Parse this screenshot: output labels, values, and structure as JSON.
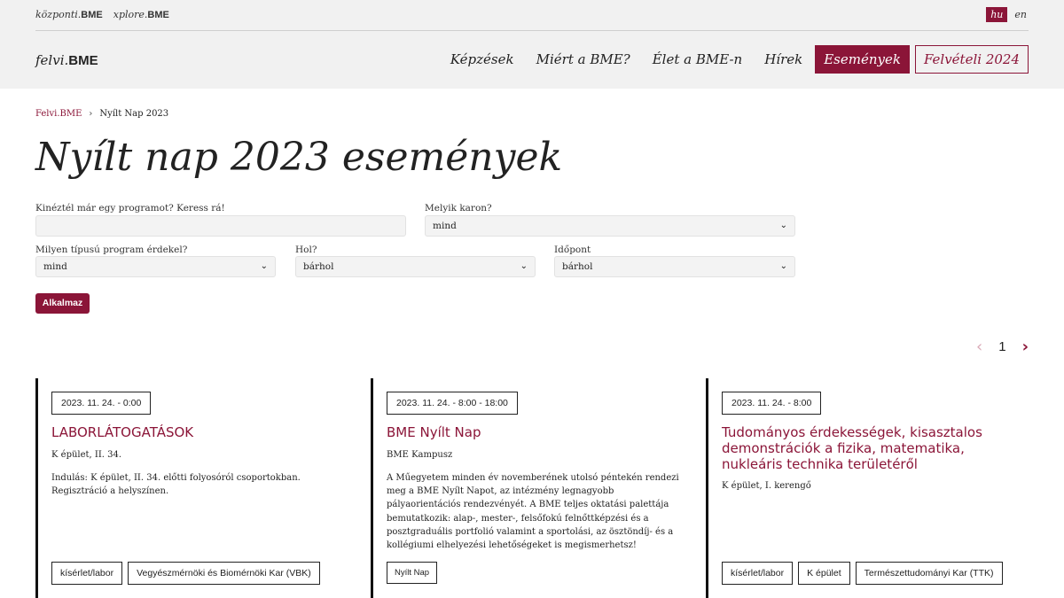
{
  "topbar": {
    "links": [
      {
        "prefix": "központi.",
        "brand": "BME"
      },
      {
        "prefix": "xplore.",
        "brand": "BME"
      }
    ],
    "lang_active": "hu",
    "lang_other": "en"
  },
  "header": {
    "logo_prefix": "felvi.",
    "logo_brand": "BME",
    "nav": {
      "kepzesek": "Képzések",
      "miert": "Miért a BME?",
      "elet": "Élet a BME-n",
      "hirek": "Hírek",
      "esemenyek": "Események",
      "felveteli": "Felvételi 2024"
    }
  },
  "breadcrumb": {
    "home": "Felvi.BME",
    "separator": "›",
    "current": "Nyílt Nap 2023"
  },
  "page_title": "Nyílt nap 2023 események",
  "filters": {
    "search_label": "Kinéztél már egy programot? Keress rá!",
    "search_value": "",
    "faculty_label": "Melyik karon?",
    "faculty_value": "mind",
    "type_label": "Milyen típusú program érdekel?",
    "type_value": "mind",
    "where_label": "Hol?",
    "where_value": "bárhol",
    "time_label": "Időpont",
    "time_value": "bárhol",
    "apply_label": "Alkalmaz",
    "chevron": "⌄"
  },
  "pager": {
    "prev": "‹",
    "current": "1",
    "next": "›"
  },
  "events": [
    {
      "date": "2023. 11. 24. - 0:00",
      "title": "LABORLÁTOGATÁSOK",
      "location": "K épület, II. 34.",
      "description": "Indulás: K épület, II. 34. előtti folyosóról csoportokban. Regisztráció a helyszínen.",
      "tags": [
        "kísérlet/labor",
        "Vegyészmérnöki és Biomérnöki Kar (VBK)"
      ]
    },
    {
      "date": "2023. 11. 24. - 8:00 - 18:00",
      "title": "BME Nyílt Nap",
      "location": "BME Kampusz",
      "description": "A Műegyetem minden év novemberének utolsó péntekén rendezi meg a BME Nyílt Napot, az intézmény legnagyobb pályaorientációs rendezvényét. A BME teljes oktatási palettája bemutatkozik: alap-, mester-, felsőfokú felnőttképzési és a posztgraduális portfolió valamint a sportolási, az ösztöndíj- és a kollégiumi elhelyezési lehetőségeket is megismerhetsz!",
      "tags": [
        "Nyílt Nap"
      ]
    },
    {
      "date": "2023. 11. 24. - 8:00",
      "title": "Tudományos érdekességek, kisasztalos demonstrációk a fizika, matematika, nukleáris technika területéről",
      "location": "K épület, I. kerengő",
      "description": "",
      "tags": [
        "kísérlet/labor",
        "K épület",
        "Természettudományi Kar (TTK)"
      ]
    }
  ],
  "colors": {
    "accent": "#8b1538",
    "header_bg": "#f1f1f1"
  }
}
